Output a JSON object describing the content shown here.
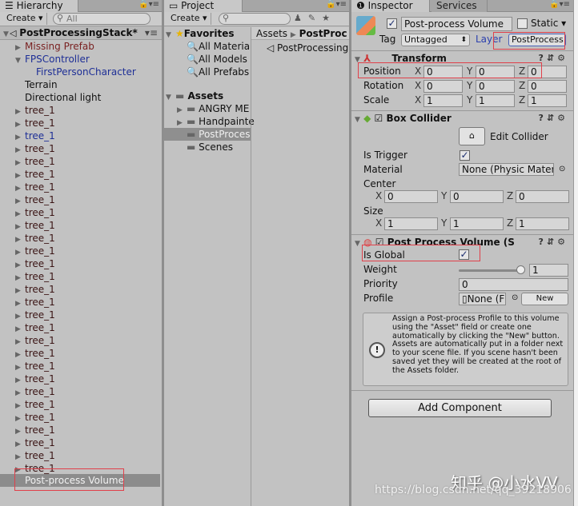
{
  "hierarchy": {
    "tab": "Hierarchy",
    "create": "Create ▾",
    "search_placeholder": "All",
    "scene": "PostProcessingStack*",
    "items": [
      {
        "label": "Missing Prefab",
        "color": "#7a2222",
        "arrow": true,
        "indent": 0
      },
      {
        "label": "FPSController",
        "color": "#1e2f96",
        "arrow": "open",
        "indent": 0
      },
      {
        "label": "FirstPersonCharacter",
        "color": "#1e2f96",
        "arrow": false,
        "indent": 1
      },
      {
        "label": "Terrain",
        "color": "#111111",
        "arrow": false,
        "indent": 0
      },
      {
        "label": "Directional light",
        "color": "#111111",
        "arrow": false,
        "indent": 0
      }
    ],
    "trees": [
      "tree_1",
      "tree_1",
      "tree_1",
      "tree_1",
      "tree_1",
      "tree_1",
      "tree_1",
      "tree_1",
      "tree_1",
      "tree_1",
      "tree_1",
      "tree_1",
      "tree_1",
      "tree_1",
      "tree_1",
      "tree_1",
      "tree_1",
      "tree_1",
      "tree_1",
      "tree_1",
      "tree_1",
      "tree_1",
      "tree_1",
      "tree_1",
      "tree_1",
      "tree_1",
      "tree_1",
      "tree_1",
      "tree_1"
    ],
    "blue_tree_index": 2,
    "selected": "Post-process Volume"
  },
  "project": {
    "tab": "Project",
    "create": "Create ▾",
    "favorites": "Favorites",
    "fav_items": [
      "All Materia",
      "All Models",
      "All Prefabs"
    ],
    "assets": "Assets",
    "asset_items": [
      {
        "label": "ANGRY ME",
        "arrow": true
      },
      {
        "label": "Handpainte",
        "arrow": true
      },
      {
        "label": "PostProces",
        "arrow": false,
        "selected": true
      },
      {
        "label": "Scenes",
        "arrow": false
      }
    ],
    "breadcrumb": [
      "Assets",
      "PostProc"
    ],
    "files": [
      "PostProcessing"
    ]
  },
  "inspector": {
    "tab": "Inspector",
    "tab2": "Services",
    "object_name": "Post-process Volume",
    "static": "Static",
    "tag_label": "Tag",
    "tag": "Untagged",
    "layer_label": "Layer",
    "layer": "PostProcess",
    "transform": {
      "title": "Transform",
      "rows": [
        {
          "label": "Position",
          "x": "0",
          "y": "0",
          "z": "0"
        },
        {
          "label": "Rotation",
          "x": "0",
          "y": "0",
          "z": "0"
        },
        {
          "label": "Scale",
          "x": "1",
          "y": "1",
          "z": "1"
        }
      ]
    },
    "box_collider": {
      "title": "Box Collider",
      "edit": "Edit Collider",
      "is_trigger": "Is Trigger",
      "material_label": "Material",
      "material": "None (Physic Materi",
      "center": "Center",
      "cx": "0",
      "cy": "0",
      "cz": "0",
      "size": "Size",
      "sx": "1",
      "sy": "1",
      "sz": "1"
    },
    "volume": {
      "title": "Post Process Volume (S",
      "is_global": "Is Global",
      "weight_label": "Weight",
      "weight": "1",
      "priority_label": "Priority",
      "priority": "0",
      "profile_label": "Profile",
      "profile": "None (F",
      "new": "New",
      "help": "Assign a Post-process Profile to this volume using the \"Asset\" field or create one automatically by clicking the \"New\" button.\nAssets are automatically put in a folder next to your scene file. If you scene hasn't been saved yet they will be created at the root of the Assets folder."
    },
    "add_component": "Add Component"
  },
  "axes": {
    "x": "X",
    "y": "Y",
    "z": "Z"
  },
  "watermark": {
    "zhihu": "知乎 @小水VV",
    "csdn": "https://blog.csdn.net/qq_39218906"
  }
}
